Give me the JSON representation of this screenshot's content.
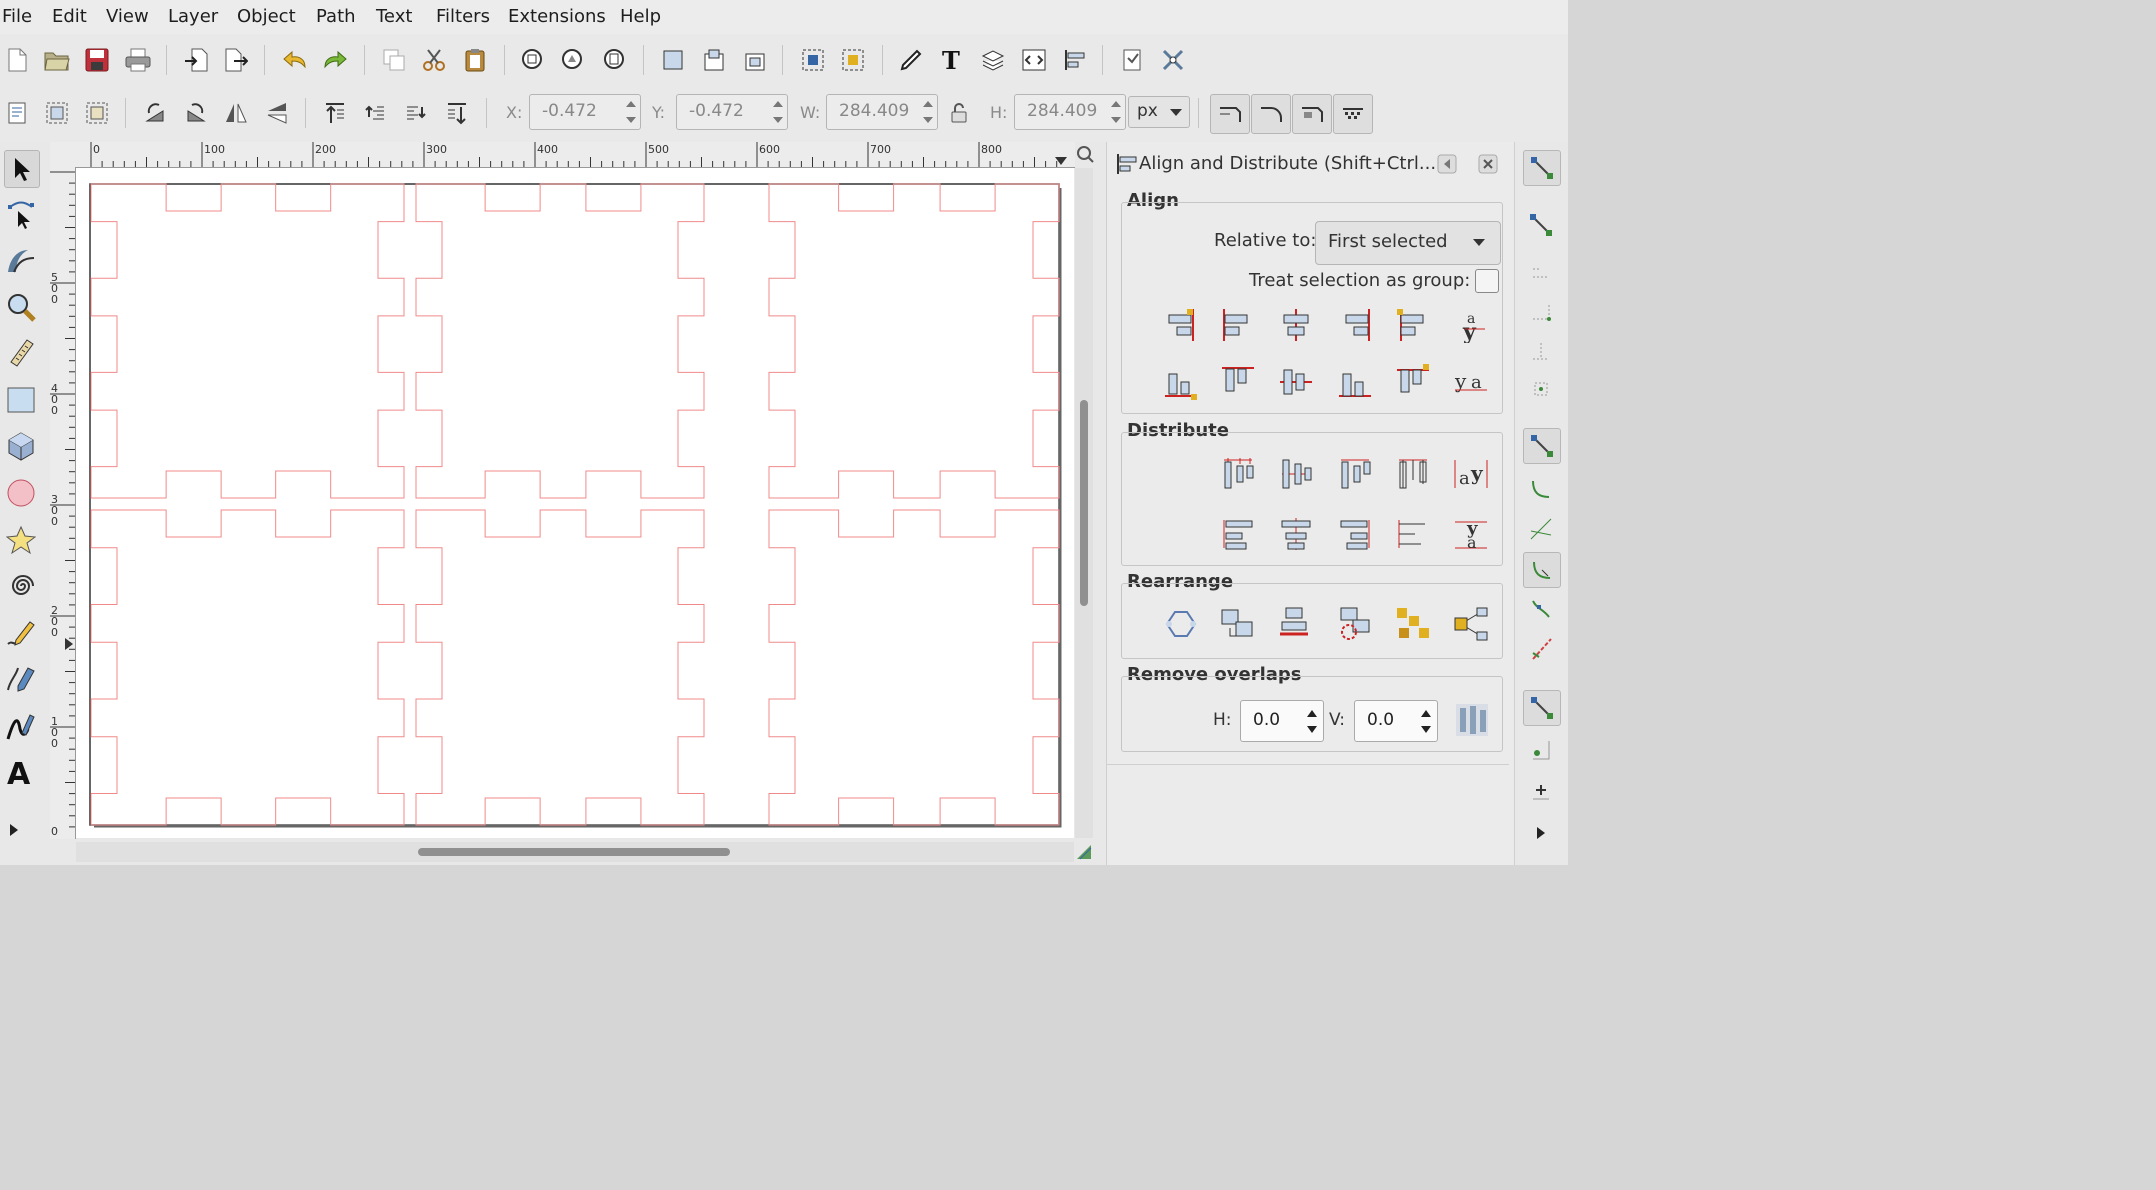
{
  "menu": [
    "File",
    "Edit",
    "View",
    "Layer",
    "Object",
    "Path",
    "Text",
    "Filters",
    "Extensions",
    "Help"
  ],
  "toolbar2": {
    "x_label": "X:",
    "x_value": "-0.472",
    "y_label": "Y:",
    "y_value": "-0.472",
    "w_label": "W:",
    "w_value": "284.409",
    "h_label": "H:",
    "h_value": "284.409",
    "unit": "px"
  },
  "ruler": {
    "h_ticks": [
      "0",
      "100",
      "200",
      "300",
      "400",
      "500",
      "600",
      "700",
      "800"
    ],
    "v_ticks": [
      "5 0 0",
      "4 0 0",
      "3 0 0",
      "2 0 0",
      "1 0 0",
      "0"
    ]
  },
  "dialog": {
    "title": "Align and Distribute (Shift+Ctrl...",
    "align": {
      "title": "Align",
      "relative_label": "Relative to:",
      "relative_value": "First selected",
      "group_label": "Treat selection as group:"
    },
    "distribute": {
      "title": "Distribute"
    },
    "rearrange": {
      "title": "Rearrange"
    },
    "overlaps": {
      "title": "Remove overlaps",
      "h_label": "H:",
      "h_value": "0.0",
      "v_label": "V:",
      "v_value": "0.0"
    }
  },
  "colors": {
    "path_stroke": "#f08a8a",
    "accent_blue": "#3465a4"
  }
}
